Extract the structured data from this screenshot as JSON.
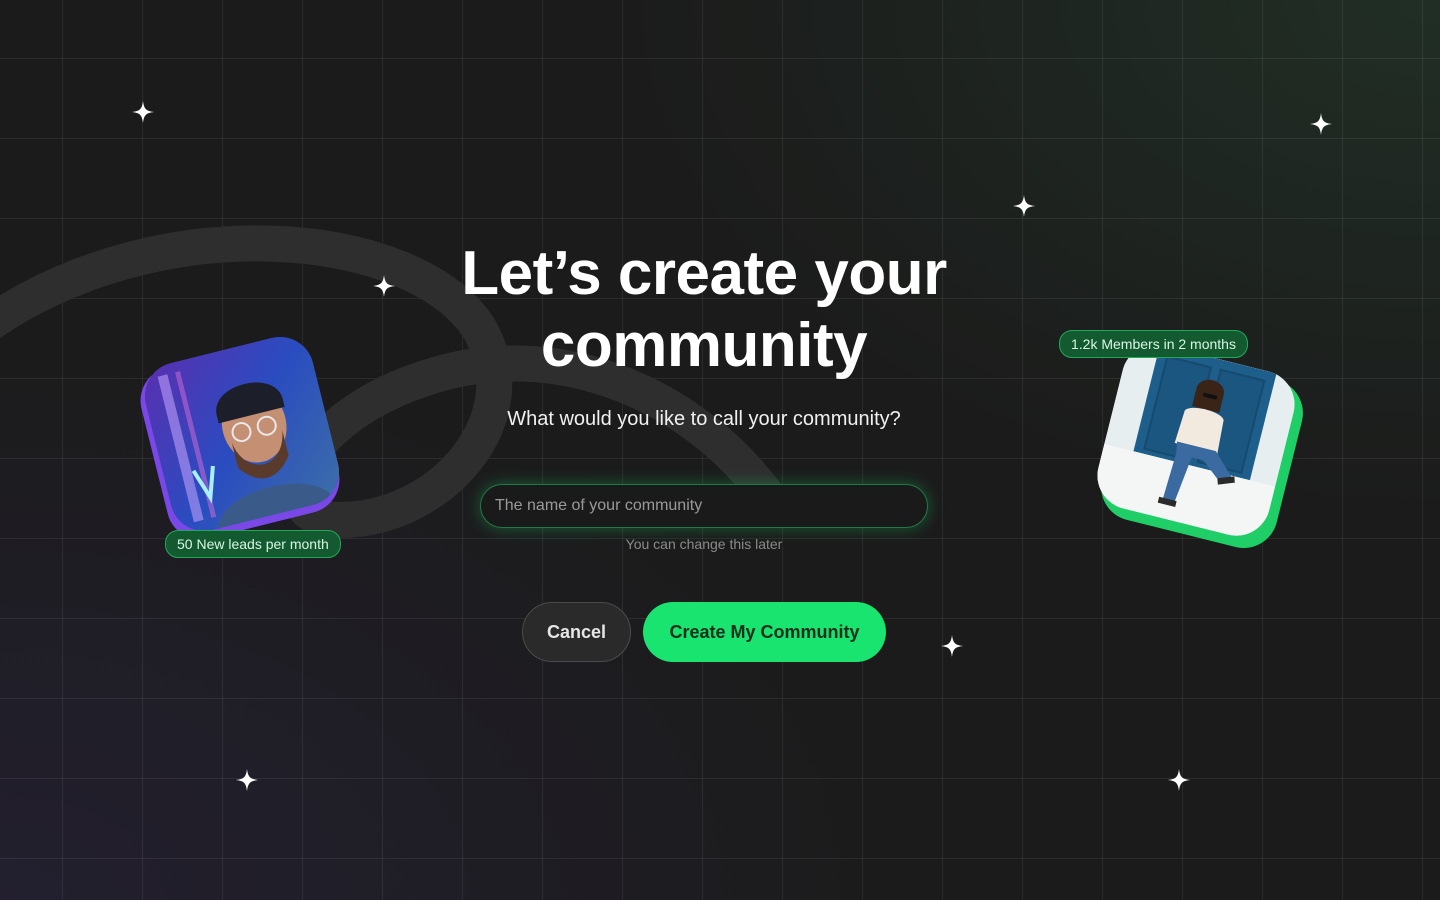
{
  "heading": {
    "line1": "Let’s create your",
    "line2": "community"
  },
  "subtitle": "What would you like to call your community?",
  "community_name_input": {
    "value": "",
    "placeholder": "The name of your community"
  },
  "hint": "You can change this later",
  "buttons": {
    "cancel_label": "Cancel",
    "create_label": "Create My Community"
  },
  "stats": {
    "left_badge": "50 New leads per month",
    "right_badge": "1.2k Members in 2 months"
  },
  "photos": {
    "left": "man-with-beanie-photo",
    "right": "woman-sitting-photo"
  },
  "icons": [
    "sparkle-icon"
  ],
  "colors": {
    "background": "#1b1b1b",
    "accent_green": "#18e46f",
    "accent_purple": "#7a48e6",
    "badge_green": "#135a30"
  }
}
